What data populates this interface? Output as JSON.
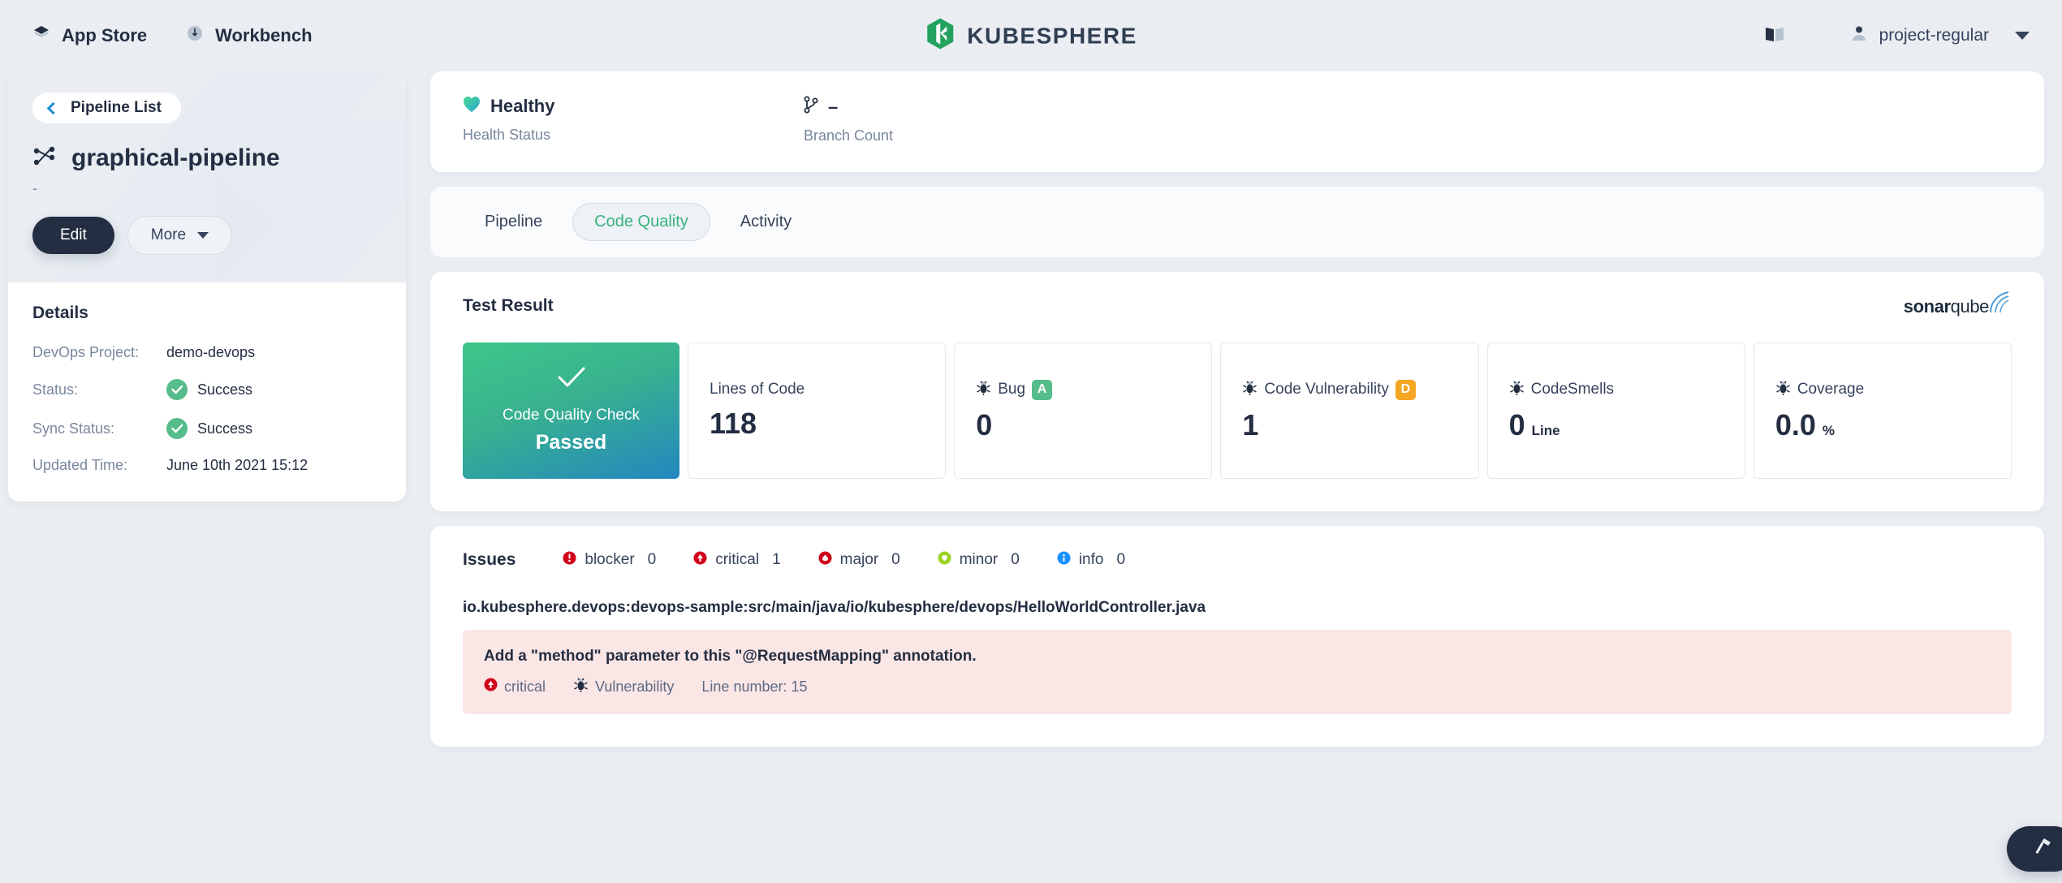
{
  "topnav": {
    "items": [
      {
        "label": "App Store",
        "icon": "layers-icon"
      },
      {
        "label": "Workbench",
        "icon": "compass-icon"
      }
    ],
    "brand": "KUBESPHERE",
    "docs_icon": "book-icon",
    "user": "project-regular",
    "user_icon": "user-avatar-icon",
    "caret_icon": "chevron-down-icon"
  },
  "sidebar": {
    "back_label": "Pipeline List",
    "back_icon": "chevron-left-icon",
    "pipeline_icon": "pipeline-icon",
    "title": "graphical-pipeline",
    "subtitle": "-",
    "edit_label": "Edit",
    "more_label": "More",
    "details_title": "Details",
    "details": [
      {
        "key": "DevOps Project:",
        "value": "demo-devops",
        "icon": null
      },
      {
        "key": "Status:",
        "value": "Success",
        "icon": "check-circle-icon"
      },
      {
        "key": "Sync Status:",
        "value": "Success",
        "icon": "check-circle-icon"
      },
      {
        "key": "Updated Time:",
        "value": "June 10th 2021 15:12",
        "icon": null
      }
    ]
  },
  "status": {
    "health": {
      "value": "Healthy",
      "label": "Health Status",
      "icon": "heart-icon"
    },
    "branch": {
      "value": "–",
      "label": "Branch Count",
      "icon": "git-branch-icon"
    }
  },
  "tabs": [
    {
      "label": "Pipeline",
      "active": false
    },
    {
      "label": "Code Quality",
      "active": true
    },
    {
      "label": "Activity",
      "active": false
    }
  ],
  "test_result": {
    "title": "Test Result",
    "provider": "sonarqube",
    "provider_mark": "sonar",
    "provider_tail": "qube",
    "pass_card": {
      "icon": "check-mark-icon",
      "label": "Code Quality Check",
      "status": "Passed"
    },
    "metrics": [
      {
        "name": "Lines of Code",
        "value": "118",
        "unit": "",
        "icon": null,
        "grade": null,
        "grade_color": null
      },
      {
        "name": "Bug",
        "value": "0",
        "unit": "",
        "icon": "bug-icon",
        "grade": "A",
        "grade_color": "#55bc8a"
      },
      {
        "name": "Code Vulnerability",
        "value": "1",
        "unit": "",
        "icon": "bug-icon",
        "grade": "D",
        "grade_color": "#f5a623"
      },
      {
        "name": "CodeSmells",
        "value": "0",
        "unit": "Line",
        "icon": "bug-icon",
        "grade": null,
        "grade_color": null
      },
      {
        "name": "Coverage",
        "value": "0.0",
        "unit": "%",
        "icon": "bug-icon",
        "grade": null,
        "grade_color": null
      }
    ]
  },
  "issues": {
    "title": "Issues",
    "severities": [
      {
        "label": "blocker",
        "count": "0",
        "color": "#d0021b",
        "icon": "blocker-icon"
      },
      {
        "label": "critical",
        "count": "1",
        "color": "#d0021b",
        "icon": "critical-icon"
      },
      {
        "label": "major",
        "count": "0",
        "color": "#d0021b",
        "icon": "major-icon"
      },
      {
        "label": "minor",
        "count": "0",
        "color": "#9bd323",
        "icon": "minor-icon"
      },
      {
        "label": "info",
        "count": "0",
        "color": "#1890ff",
        "icon": "info-icon"
      }
    ],
    "file_path": "io.kubesphere.devops:devops-sample:src/main/java/io/kubesphere/devops/HelloWorldController.java",
    "detail": {
      "message": "Add a \"method\" parameter to this \"@RequestMapping\" annotation.",
      "severity": "critical",
      "type": "Vulnerability",
      "line": "Line number: 15"
    }
  },
  "fab": {
    "icon": "hammer-icon"
  },
  "colors": {
    "accent_green": "#36b37e",
    "dark": "#242e42",
    "page_bg": "#eaeef3",
    "issue_bg": "#fbe6e6"
  }
}
